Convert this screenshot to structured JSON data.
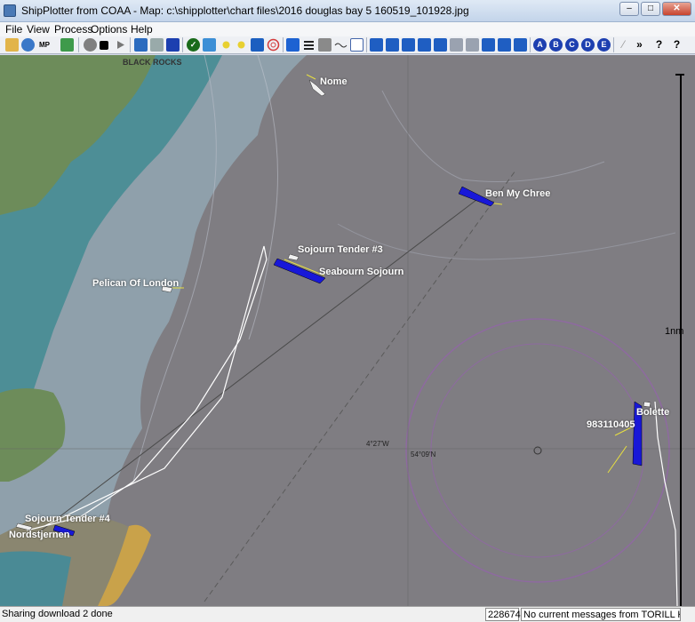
{
  "window": {
    "title": "ShipPlotter from COAA - Map: c:\\shipplotter\\chart files\\2016 douglas bay 5 160519_101928.jpg"
  },
  "menu": {
    "items": [
      "File",
      "View",
      "Process",
      "Options",
      "Help"
    ]
  },
  "toolbar": {
    "letter_buttons": [
      "A",
      "B",
      "C",
      "D",
      "E"
    ],
    "map_button": "MP"
  },
  "map": {
    "vessels": [
      {
        "name": "Nome",
        "color": "#f0f0f0"
      },
      {
        "name": "Ben My Chree",
        "color": "#1818d8"
      },
      {
        "name": "Sojourn Tender #3",
        "color": "#f0f0f0"
      },
      {
        "name": "Seabourn Sojourn",
        "color": "#1818d8"
      },
      {
        "name": "Pelican Of London",
        "color": "#f0f0f0"
      },
      {
        "name": "Bolette",
        "color": "#1818d8"
      },
      {
        "name": "983110405",
        "color": "#1818d8"
      },
      {
        "name": "Sojourn Tender #4",
        "color": "#f0f0f0"
      },
      {
        "name": "Nordstjernen",
        "color": "#1818d8"
      }
    ],
    "chart_text": {
      "black_rocks": "BLACK ROCKS",
      "coord_lon": "4°27'W",
      "coord_lat": "54°09'N",
      "scale": "1nm"
    }
  },
  "status": {
    "message": "Sharing download 2 done",
    "counter": "228674",
    "current": "No current messages from TORILL KNUTSEN"
  }
}
